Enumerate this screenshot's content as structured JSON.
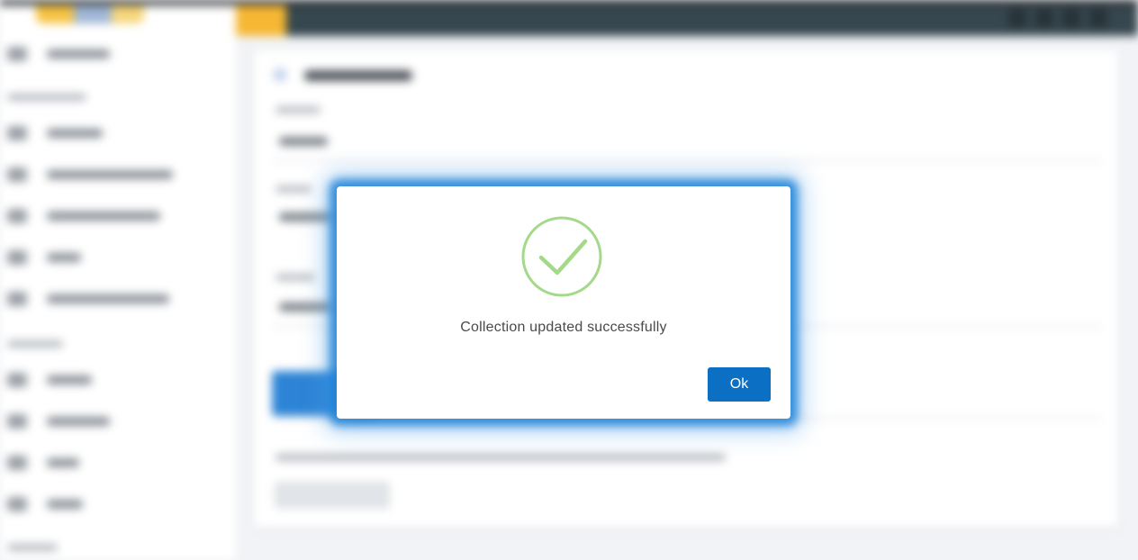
{
  "dialog": {
    "message": "Collection updated successfully",
    "ok_label": "Ok",
    "icon": "check-circle-icon",
    "colors": {
      "check": "#a5d98a",
      "button": "#0b6fc3",
      "glow": "#1e82d7"
    }
  }
}
